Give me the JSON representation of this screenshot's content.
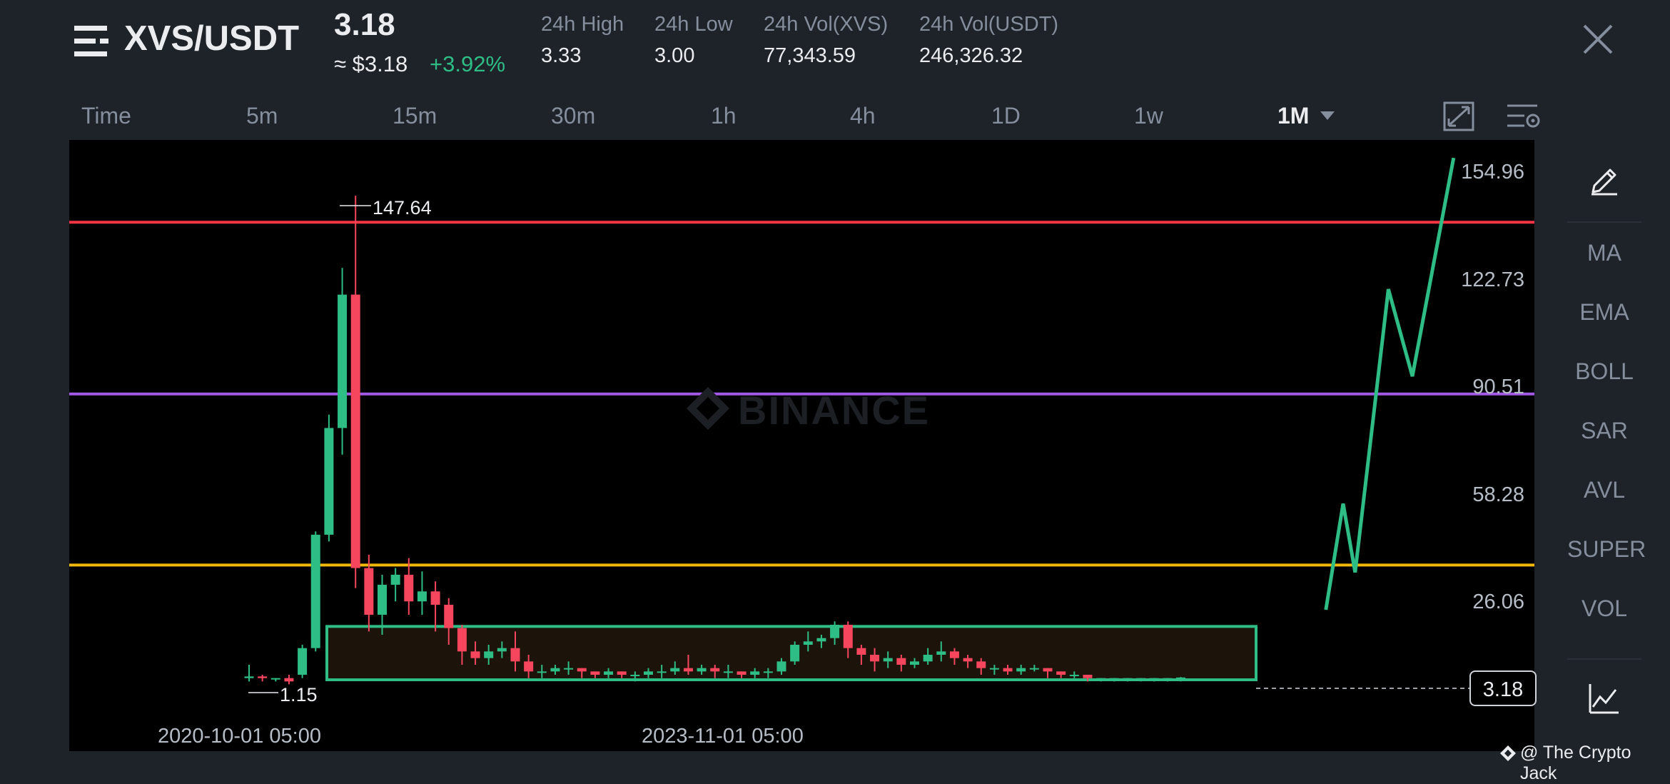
{
  "header": {
    "pair": "XVS/USDT",
    "price": "3.18",
    "price_usd": "≈ $3.18",
    "change": "+3.92%",
    "stats": [
      {
        "label": "24h High",
        "value": "3.33"
      },
      {
        "label": "24h Low",
        "value": "3.00"
      },
      {
        "label": "24h Vol(XVS)",
        "value": "77,343.59"
      },
      {
        "label": "24h Vol(USDT)",
        "value": "246,326.32"
      }
    ],
    "icons": {
      "menu": "menu-list-icon",
      "close": "close-icon"
    }
  },
  "timeframes": [
    "Time",
    "5m",
    "15m",
    "30m",
    "1h",
    "4h",
    "1D",
    "1w",
    "1M"
  ],
  "active_timeframe": "1M",
  "toolbar": {
    "items": [
      "MA",
      "EMA",
      "BOLL",
      "SAR",
      "AVL",
      "SUPER",
      "VOL"
    ],
    "icons": {
      "top": "pencil-icon",
      "bottom": "line-chart-icon",
      "fullscreen": "fullscreen-icon",
      "settings": "chart-settings-icon"
    }
  },
  "chart_data": {
    "type": "candlestick",
    "watermark": "BINANCE",
    "y_ticks": [
      "154.96",
      "122.73",
      "90.51",
      "58.28",
      "26.06"
    ],
    "y_tick_values": [
      154.96,
      122.73,
      90.51,
      58.28,
      26.06
    ],
    "x_ticks": [
      "2020-10-01 05:00",
      "2023-11-01 05:00"
    ],
    "high_label": "147.64",
    "low_label": "1.15",
    "current_price_label": "3.18",
    "current_price": 3.18,
    "horizontal_lines": [
      {
        "value": 139.7,
        "color": "#f23645"
      },
      {
        "value": 88.2,
        "color": "#a259e6"
      },
      {
        "value": 36.9,
        "color": "#f0b90b"
      }
    ],
    "range_box": {
      "low": 2.5,
      "high": 18.5
    },
    "candles": [
      [
        3,
        3.5,
        2,
        7
      ],
      [
        3.5,
        3,
        2,
        4
      ],
      [
        3,
        3,
        2,
        3
      ],
      [
        3,
        2,
        1.15,
        4
      ],
      [
        4,
        12,
        3,
        13
      ],
      [
        12,
        46,
        11,
        47
      ],
      [
        46,
        78,
        44,
        82
      ],
      [
        78,
        118,
        70,
        126
      ],
      [
        118,
        36,
        30,
        147.64
      ],
      [
        36,
        22,
        17,
        40
      ],
      [
        22,
        31,
        16,
        34
      ],
      [
        31,
        34,
        26,
        36
      ],
      [
        34,
        26,
        22,
        39
      ],
      [
        26,
        29,
        22,
        35
      ],
      [
        29,
        25,
        17,
        32
      ],
      [
        25,
        18,
        13,
        27
      ],
      [
        18,
        11,
        7,
        19
      ],
      [
        11,
        9,
        7,
        14
      ],
      [
        9,
        11,
        7,
        13
      ],
      [
        11,
        12,
        9,
        14
      ],
      [
        12,
        8,
        5,
        17
      ],
      [
        8,
        5,
        3,
        10
      ],
      [
        5,
        5,
        3,
        7
      ],
      [
        5,
        6,
        4,
        7
      ],
      [
        6,
        6,
        4,
        8
      ],
      [
        6,
        5,
        3,
        6
      ],
      [
        5,
        4,
        3,
        5
      ],
      [
        4,
        5,
        3,
        6
      ],
      [
        5,
        4,
        3,
        5
      ],
      [
        4,
        4,
        2,
        5
      ],
      [
        4,
        5,
        3,
        6
      ],
      [
        5,
        5,
        3,
        7
      ],
      [
        5,
        6,
        4,
        8
      ],
      [
        6,
        5,
        4,
        10
      ],
      [
        5,
        6,
        4,
        7
      ],
      [
        6,
        5,
        3,
        7
      ],
      [
        5,
        5,
        3,
        7
      ],
      [
        5,
        4,
        3,
        5
      ],
      [
        4,
        5,
        3,
        6
      ],
      [
        5,
        5,
        3,
        6
      ],
      [
        5,
        8,
        4,
        9
      ],
      [
        8,
        13,
        7,
        14
      ],
      [
        13,
        14,
        11,
        17
      ],
      [
        14,
        15,
        12,
        16
      ],
      [
        15,
        19,
        13,
        20
      ],
      [
        19,
        12,
        9,
        20
      ],
      [
        12,
        10,
        7,
        13
      ],
      [
        10,
        8,
        5,
        12
      ],
      [
        8,
        9,
        6,
        11
      ],
      [
        9,
        7,
        5,
        10
      ],
      [
        7,
        8,
        6,
        9
      ],
      [
        8,
        10,
        7,
        12
      ],
      [
        10,
        11,
        8,
        14
      ],
      [
        11,
        9,
        7,
        12
      ],
      [
        9,
        8,
        6,
        10
      ],
      [
        8,
        6,
        4,
        9
      ],
      [
        6,
        6,
        4,
        7
      ],
      [
        6,
        5,
        4,
        7
      ],
      [
        5,
        6,
        4,
        7
      ],
      [
        6,
        6,
        5,
        7
      ],
      [
        6,
        5,
        3,
        6
      ],
      [
        5,
        4,
        3,
        5
      ],
      [
        4,
        4,
        3,
        5
      ],
      [
        4,
        3,
        2,
        4
      ],
      [
        3,
        3,
        2,
        3
      ],
      [
        3,
        3,
        2,
        3
      ],
      [
        3,
        3,
        2,
        3
      ],
      [
        3,
        3,
        2,
        3
      ],
      [
        3,
        3,
        2,
        3
      ],
      [
        3,
        3,
        2,
        3
      ],
      [
        3,
        3.18,
        2,
        3.33
      ]
    ],
    "projection_path": [
      {
        "candle": 80.9,
        "value": 23.5
      },
      {
        "candle": 82.2,
        "value": 55.3
      },
      {
        "candle": 83.1,
        "value": 34.7
      },
      {
        "candle": 85.6,
        "value": 119.6
      },
      {
        "candle": 87.4,
        "value": 93.5
      },
      {
        "candle": 90.5,
        "value": 159.0
      }
    ]
  },
  "credit": "@ The Crypto Jack"
}
